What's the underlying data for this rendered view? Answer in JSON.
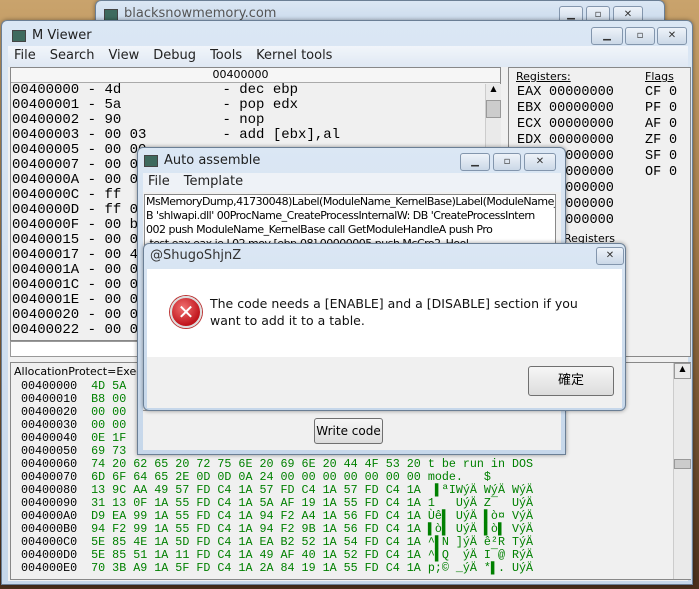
{
  "bg_window": {
    "title": "blacksnowmemory.com"
  },
  "main": {
    "title": "M Viewer",
    "menu": [
      "File",
      "Search",
      "View",
      "Debug",
      "Tools",
      "Kernel tools"
    ],
    "disasm": {
      "header": "00400000",
      "rows": [
        {
          "a": "00400000",
          "b": "4d",
          "i": "dec ebp"
        },
        {
          "a": "00400001",
          "b": "5a",
          "i": "pop edx"
        },
        {
          "a": "00400002",
          "b": "90",
          "i": "nop"
        },
        {
          "a": "00400003",
          "b": "00 03",
          "i": "add [ebx],al"
        },
        {
          "a": "00400005",
          "b": "00 00",
          "i": ""
        },
        {
          "a": "00400007",
          "b": "00 04",
          "i": ""
        },
        {
          "a": "0040000A",
          "b": "00 00",
          "i": ""
        },
        {
          "a": "0040000C",
          "b": "ff",
          "i": ""
        },
        {
          "a": "0040000D",
          "b": "ff 00",
          "i": ""
        },
        {
          "a": "0040000F",
          "b": "00 b8",
          "i": ""
        },
        {
          "a": "00400015",
          "b": "00 00",
          "i": ""
        },
        {
          "a": "00400017",
          "b": "00 40",
          "i": ""
        },
        {
          "a": "0040001A",
          "b": "00 00",
          "i": ""
        },
        {
          "a": "0040001C",
          "b": "00 00",
          "i": ""
        },
        {
          "a": "0040001E",
          "b": "00 00",
          "i": ""
        },
        {
          "a": "00400020",
          "b": "00 00",
          "i": ""
        },
        {
          "a": "00400022",
          "b": "00 00",
          "i": ""
        }
      ]
    },
    "registers": {
      "label": "Registers:",
      "flags_label": "Flags",
      "regs": [
        {
          "n": "EAX",
          "v": "00000000"
        },
        {
          "n": "EBX",
          "v": "00000000"
        },
        {
          "n": "ECX",
          "v": "00000000"
        },
        {
          "n": "EDX",
          "v": "00000000"
        },
        {
          "n": "",
          "v": "00000000"
        },
        {
          "n": "",
          "v": "00000000"
        },
        {
          "n": "",
          "v": "00000000"
        },
        {
          "n": "",
          "v": "00000000"
        },
        {
          "n": "",
          "v": "00000000"
        }
      ],
      "flags": [
        {
          "n": "CF",
          "v": "0"
        },
        {
          "n": "PF",
          "v": "0"
        },
        {
          "n": "AF",
          "v": "0"
        },
        {
          "n": "ZF",
          "v": "0"
        },
        {
          "n": "SF",
          "v": "0"
        },
        {
          "n": "OF",
          "v": "0"
        }
      ],
      "more_label": "Registers"
    },
    "hex": {
      "info": "AllocationProtect=Execute",
      "rows": [
        {
          "a": "00400000",
          "b": "4D 5A",
          "t": ""
        },
        {
          "a": "00400010",
          "b": "B8 00",
          "t": ""
        },
        {
          "a": "00400020",
          "b": "00 00",
          "t": ""
        },
        {
          "a": "00400030",
          "b": "00 00",
          "t": ""
        },
        {
          "a": "00400040",
          "b": "0E 1F",
          "t": ""
        },
        {
          "a": "00400050",
          "b": "69 73",
          "t": ""
        },
        {
          "a": "00400060",
          "b": "74 20 62 65 20 72 75 6E 20 69 6E 20 44 4F 53 20",
          "t": "t be run in DOS"
        },
        {
          "a": "00400070",
          "b": "6D 6F 64 65 2E 0D 0D 0A 24 00 00 00 00 00 00 00",
          "t": "mode.   $"
        },
        {
          "a": "00400080",
          "b": "13 9C AA 49 57 FD C4 1A 57 FD C4 1A 57 FD C4 1A",
          "t": " ▌ªIWýÄ WýÄ WýÄ"
        },
        {
          "a": "00400090",
          "b": "31 13 0F 1A 55 FD C4 1A 5A AF 19 1A 55 FD C4 1A",
          "t": "1   UýÄ Z¯  UýÄ"
        },
        {
          "a": "004000A0",
          "b": "D9 EA 99 1A 55 FD C4 1A 94 F2 A4 1A 56 FD C4 1A",
          "t": "Ùê▌ UýÄ ▌ò¤ VýÄ"
        },
        {
          "a": "004000B0",
          "b": "94 F2 99 1A 55 FD C4 1A 94 F2 9B 1A 56 FD C4 1A",
          "t": "▌ò▌ UýÄ ▌ò▌ VýÄ"
        },
        {
          "a": "004000C0",
          "b": "5E 85 4E 1A 5D FD C4 1A EA B2 52 1A 54 FD C4 1A",
          "t": "^▌N ]ýÄ ê²R TýÄ"
        },
        {
          "a": "004000D0",
          "b": "5E 85 51 1A 11 FD C4 1A 49 AF 40 1A 52 FD C4 1A",
          "t": "^▌Q  ýÄ I¯@ RýÄ"
        },
        {
          "a": "004000E0",
          "b": "70 3B A9 1A 5F FD C4 1A 2A 84 19 1A 55 FD C4 1A",
          "t": "p;© _ýÄ *▌. UýÄ"
        }
      ]
    }
  },
  "auto_assemble": {
    "title": "Auto assemble",
    "menu": [
      "File",
      "Template"
    ],
    "code_lines": [
      "MsMemoryDump,41730048)Label(ModuleName_KernelBase)Label(ModuleName_K",
      "B 'shlwapi.dll' 00ProcName_CreateProcessInternalW:       DB 'CreateProcessIntern",
      "002      push ModuleName_KernelBase        call GetModuleHandleA        push Pro",
      "-test eax,eax        je L02            mov [ebp-08],00000005        push McCro2_Hool"
    ],
    "write_button": "Write code"
  },
  "message_box": {
    "title": "@ShugoShjnZ",
    "message": "The code needs a [ENABLE] and a [DISABLE] section if you want to add it to a table.",
    "ok_button": "確定",
    "icon": "error-icon"
  }
}
